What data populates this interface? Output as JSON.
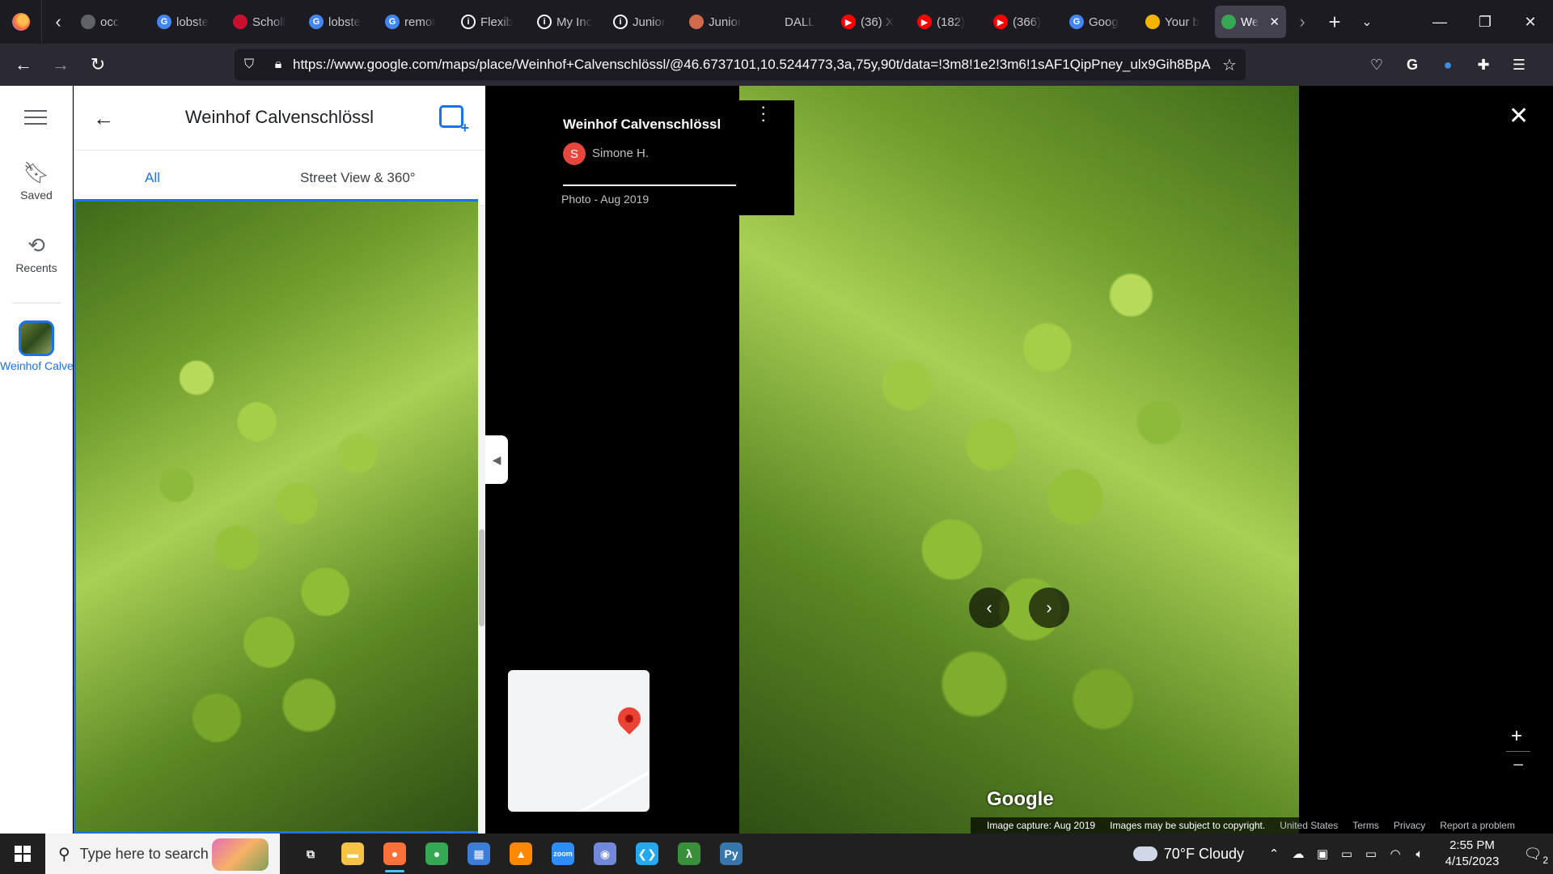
{
  "browser": {
    "tabs": [
      {
        "title": "occ",
        "icon": "generic-icon",
        "color": "#5f6368"
      },
      {
        "title": "lobste",
        "icon": "google-icon",
        "color": "#4285f4"
      },
      {
        "title": "Scholl",
        "icon": "scholl-icon",
        "color": "#c8102e"
      },
      {
        "title": "lobste",
        "icon": "google-icon",
        "color": "#4285f4"
      },
      {
        "title": "remot",
        "icon": "google-icon",
        "color": "#4285f4"
      },
      {
        "title": "Flexib",
        "icon": "info-icon",
        "color": "#fbfbfe"
      },
      {
        "title": "My Inc",
        "icon": "info-icon",
        "color": "#fbfbfe"
      },
      {
        "title": "Junior",
        "icon": "info-icon",
        "color": "#fbfbfe"
      },
      {
        "title": "Junior",
        "icon": "generic-icon",
        "color": "#d06a4a"
      },
      {
        "title": "DALL",
        "icon": "openai-icon",
        "color": "#fbfbfe"
      },
      {
        "title": "(36) X",
        "icon": "youtube-icon",
        "color": "#ff0000"
      },
      {
        "title": "(182)",
        "icon": "youtube-icon",
        "color": "#ff0000"
      },
      {
        "title": "(366)",
        "icon": "youtube-icon",
        "color": "#ff0000"
      },
      {
        "title": "Goog",
        "icon": "google-icon",
        "color": "#4285f4"
      },
      {
        "title": "Your b",
        "icon": "slides-icon",
        "color": "#f4b400"
      },
      {
        "title": "We",
        "icon": "maps-icon",
        "color": "#34a853",
        "active": true
      }
    ],
    "url": "https://www.google.com/maps/place/Weinhof+Calvenschlössl/@46.6737101,10.5244773,3a,75y,90t/data=!3m8!1e2!3m6!1sAF1QipPney_ulx9Gih8BpA"
  },
  "maps": {
    "rail": {
      "saved_label": "Saved",
      "recents_label": "Recents",
      "place_label": "Weinhof Calvenschlö"
    },
    "panel": {
      "title": "Weinhof Calvenschlössl",
      "tabs": [
        "All",
        "Street View & 360°"
      ]
    },
    "viewer": {
      "place_name": "Weinhof Calvenschlössl",
      "author_initial": "S",
      "author_name": "Simone H.",
      "photo_date": "Photo - Aug 2019",
      "logo": "Google",
      "attribution": {
        "capture": "Image capture: Aug 2019",
        "copyright": "Images may be subject to copyright.",
        "region": "United States",
        "terms": "Terms",
        "privacy": "Privacy",
        "report": "Report a problem"
      }
    }
  },
  "taskbar": {
    "search_placeholder": "Type here to search",
    "apps": [
      {
        "name": "task-view",
        "glyph": "⧉",
        "color": "#202020"
      },
      {
        "name": "file-explorer",
        "glyph": "▬",
        "color": "#f6c344"
      },
      {
        "name": "firefox",
        "glyph": "●",
        "color": "#ff7139",
        "active": true
      },
      {
        "name": "chrome",
        "glyph": "●",
        "color": "#34a853"
      },
      {
        "name": "calculator",
        "glyph": "▦",
        "color": "#3b7dd8"
      },
      {
        "name": "vlc",
        "glyph": "▲",
        "color": "#ff8800"
      },
      {
        "name": "zoom",
        "glyph": "zoom",
        "color": "#2d8cff"
      },
      {
        "name": "discord",
        "glyph": "◉",
        "color": "#7289da"
      },
      {
        "name": "vscode",
        "glyph": "❮❯",
        "color": "#23a9f2"
      },
      {
        "name": "lambda-app",
        "glyph": "λ",
        "color": "#3a8f3a"
      },
      {
        "name": "python",
        "glyph": "Py",
        "color": "#3776ab"
      }
    ],
    "weather": "70°F  Cloudy",
    "time": "2:55 PM",
    "date": "4/15/2023",
    "notification_count": "2"
  }
}
